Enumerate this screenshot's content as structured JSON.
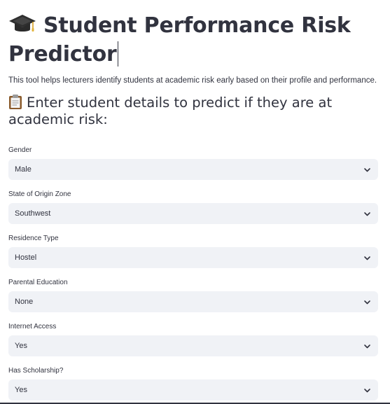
{
  "page": {
    "title_emoji": "graduation-cap-icon",
    "title": "Student Performance Risk Predictor",
    "intro": "This tool helps lecturers identify students at academic risk early based on their profile and performance.",
    "subheading_icon": "clipboard-icon",
    "subheading": "Enter student details to predict if they are at academic risk:"
  },
  "form": {
    "fields": [
      {
        "label": "Gender",
        "value": "Male"
      },
      {
        "label": "State of Origin Zone",
        "value": "Southwest"
      },
      {
        "label": "Residence Type",
        "value": "Hostel"
      },
      {
        "label": "Parental Education",
        "value": "None"
      },
      {
        "label": "Internet Access",
        "value": "Yes"
      },
      {
        "label": "Has Scholarship?",
        "value": "Yes"
      }
    ]
  },
  "colors": {
    "text": "#31333f",
    "select_background": "#f0f2f6",
    "background": "#ffffff"
  }
}
